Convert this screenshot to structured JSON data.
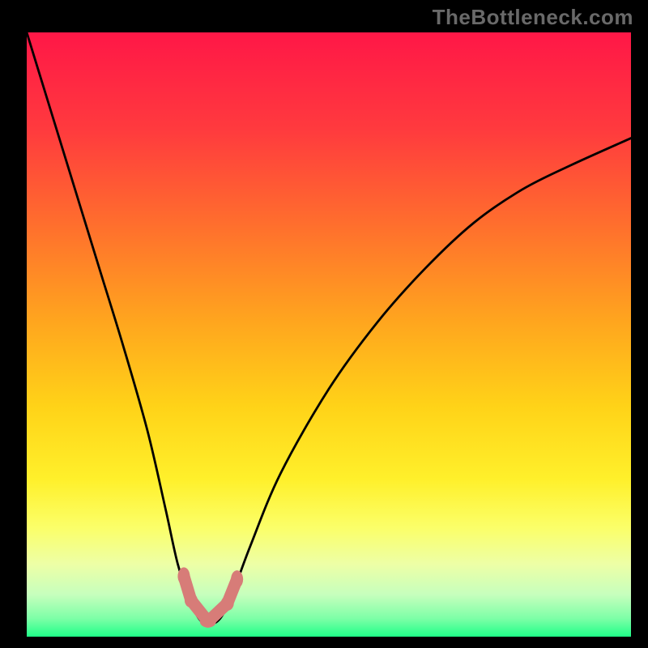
{
  "watermark": "TheBottleneck.com",
  "colors": {
    "background": "#000000",
    "watermark": "#696969",
    "curve": "#000000",
    "marker": "#d77c78",
    "gradient_stops": [
      {
        "offset": 0.0,
        "color": "#ff1747"
      },
      {
        "offset": 0.16,
        "color": "#ff3a3e"
      },
      {
        "offset": 0.32,
        "color": "#ff6f2d"
      },
      {
        "offset": 0.48,
        "color": "#ffa61e"
      },
      {
        "offset": 0.62,
        "color": "#ffd318"
      },
      {
        "offset": 0.74,
        "color": "#fff02b"
      },
      {
        "offset": 0.82,
        "color": "#fbff69"
      },
      {
        "offset": 0.88,
        "color": "#edffa6"
      },
      {
        "offset": 0.93,
        "color": "#c7ffbd"
      },
      {
        "offset": 0.97,
        "color": "#7dffa7"
      },
      {
        "offset": 1.0,
        "color": "#1fff88"
      }
    ]
  },
  "chart_data": {
    "type": "line",
    "title": "",
    "xlabel": "",
    "ylabel": "",
    "x_range": [
      0,
      100
    ],
    "y_range": [
      0,
      100
    ],
    "note": "Axes are normalized 0-100; raw tick labels are not shown in the image. Values estimated from pixel positions.",
    "series": [
      {
        "name": "curve",
        "x": [
          0,
          4,
          8,
          12,
          16,
          20,
          23,
          25,
          27,
          28.5,
          30,
          32,
          34,
          37,
          42,
          50,
          58,
          66,
          74,
          82,
          90,
          100
        ],
        "y": [
          100,
          87,
          74,
          61,
          48,
          34,
          21,
          12,
          6,
          3,
          2,
          3,
          7,
          15,
          27,
          41,
          52,
          61,
          68.5,
          74,
          78,
          82.5
        ]
      }
    ],
    "markers": [
      {
        "x": 26.0,
        "y": 10.0
      },
      {
        "x": 27.2,
        "y": 6.0
      },
      {
        "x": 30.0,
        "y": 2.5
      },
      {
        "x": 33.2,
        "y": 5.5
      },
      {
        "x": 34.8,
        "y": 9.5
      }
    ],
    "annotations": []
  }
}
